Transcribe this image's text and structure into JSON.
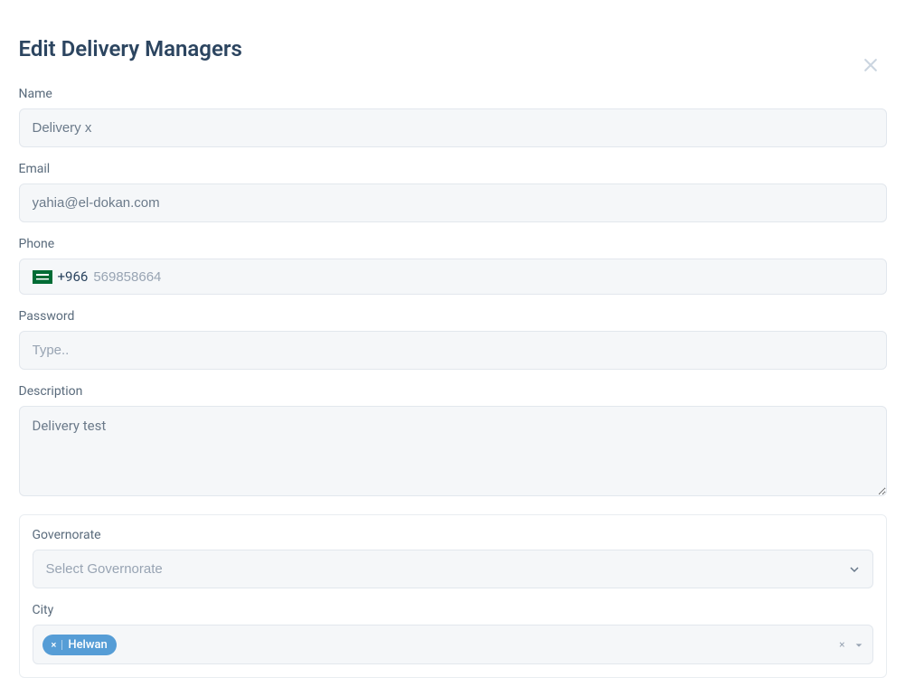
{
  "modal": {
    "title": "Edit Delivery Managers"
  },
  "form": {
    "name": {
      "label": "Name",
      "value": "Delivery x"
    },
    "email": {
      "label": "Email",
      "value": "yahia@el-dokan.com"
    },
    "phone": {
      "label": "Phone",
      "prefix": "+966",
      "value": "569858664"
    },
    "password": {
      "label": "Password",
      "placeholder": "Type.."
    },
    "description": {
      "label": "Description",
      "value": "Delivery test"
    },
    "governorate": {
      "label": "Governorate",
      "placeholder": "Select Governorate"
    },
    "city": {
      "label": "City",
      "tags": [
        "Helwan"
      ]
    }
  }
}
